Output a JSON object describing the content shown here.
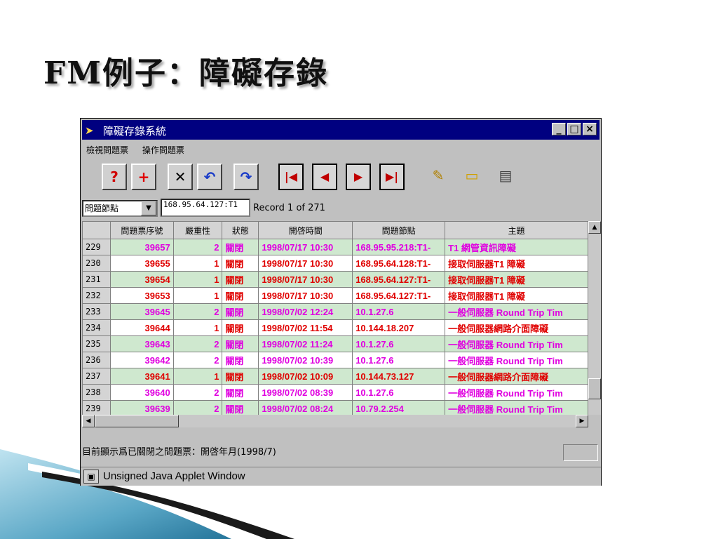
{
  "slide": {
    "title": "FM例子：障礙存錄"
  },
  "window": {
    "title": "障礙存錄系統",
    "min_btn": "_",
    "max_btn": "□",
    "close_btn": "×"
  },
  "menu": {
    "items": [
      "檢視問題票",
      "操作問題票"
    ]
  },
  "toolbar": {
    "buttons": [
      "help-icon",
      "add-icon",
      "delete-icon",
      "undo-icon",
      "redo-icon",
      "first-record-icon",
      "prev-record-icon",
      "next-record-icon",
      "last-record-icon",
      "pin-note-icon",
      "open-folder-icon",
      "export-icon"
    ]
  },
  "filter": {
    "field_label": "問題節點",
    "node_value": "168.95.64.127:T1",
    "record_text": "Record 1 of 271"
  },
  "table": {
    "columns": [
      "",
      "問題票序號",
      "嚴重性",
      "狀態",
      "開啓時間",
      "問題節點",
      "主題"
    ],
    "rows": [
      {
        "rn": "229",
        "ticket": "39657",
        "sev": "2",
        "status": "關閉",
        "time": "1998/07/17  10:30",
        "node": "168.95.95.218:T1-",
        "subject": "T1 網管資訊障礙"
      },
      {
        "rn": "230",
        "ticket": "39655",
        "sev": "1",
        "status": "關閉",
        "time": "1998/07/17  10:30",
        "node": "168.95.64.128:T1-",
        "subject": "接取伺服器T1 障礙"
      },
      {
        "rn": "231",
        "ticket": "39654",
        "sev": "1",
        "status": "關閉",
        "time": "1998/07/17  10:30",
        "node": "168.95.64.127:T1-",
        "subject": "接取伺服器T1 障礙"
      },
      {
        "rn": "232",
        "ticket": "39653",
        "sev": "1",
        "status": "關閉",
        "time": "1998/07/17  10:30",
        "node": "168.95.64.127:T1-",
        "subject": "接取伺服器T1 障礙"
      },
      {
        "rn": "233",
        "ticket": "39645",
        "sev": "2",
        "status": "關閉",
        "time": "1998/07/02  12:24",
        "node": "10.1.27.6",
        "subject": "一般伺服器 Round Trip Tim"
      },
      {
        "rn": "234",
        "ticket": "39644",
        "sev": "1",
        "status": "關閉",
        "time": "1998/07/02  11:54",
        "node": "10.144.18.207",
        "subject": "一般伺服器網路介面障礙"
      },
      {
        "rn": "235",
        "ticket": "39643",
        "sev": "2",
        "status": "關閉",
        "time": "1998/07/02  11:24",
        "node": "10.1.27.6",
        "subject": "一般伺服器 Round Trip Tim"
      },
      {
        "rn": "236",
        "ticket": "39642",
        "sev": "2",
        "status": "關閉",
        "time": "1998/07/02  10:39",
        "node": "10.1.27.6",
        "subject": "一般伺服器 Round Trip Tim"
      },
      {
        "rn": "237",
        "ticket": "39641",
        "sev": "1",
        "status": "關閉",
        "time": "1998/07/02  10:09",
        "node": "10.144.73.127",
        "subject": "一般伺服器網路介面障礙"
      },
      {
        "rn": "238",
        "ticket": "39640",
        "sev": "2",
        "status": "關閉",
        "time": "1998/07/02  08:39",
        "node": "10.1.27.6",
        "subject": "一般伺服器 Round Trip Tim"
      },
      {
        "rn": "239",
        "ticket": "39639",
        "sev": "2",
        "status": "關閉",
        "time": "1998/07/02  08:24",
        "node": "10.79.2.254",
        "subject": "一般伺服器 Round Trip Tim"
      }
    ]
  },
  "status": {
    "text": "目前顯示爲已關閉之問題票：開啓年月(1998/7)",
    "applet_warning": "Unsigned Java Applet Window"
  },
  "colors": {
    "severity1": "#e00000",
    "severity2": "#e000e0",
    "row_alt": "#cfe8cf",
    "titlebar": "#000080"
  }
}
